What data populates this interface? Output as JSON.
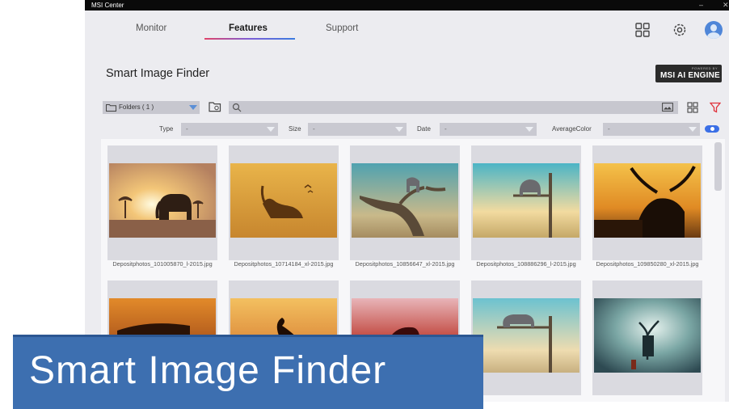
{
  "window": {
    "title": "MSI Center"
  },
  "nav": {
    "tabs": [
      "Monitor",
      "Features",
      "Support"
    ],
    "active_tab": "Features"
  },
  "page": {
    "title": "Smart Image Finder",
    "badge_small": "POWERED BY",
    "badge_main": "MSI AI ENGINE"
  },
  "toolbar": {
    "folder_label": "Folders ( 1 )",
    "search_value": ""
  },
  "filters": {
    "type_label": "Type",
    "type_value": "-",
    "size_label": "Size",
    "size_value": "-",
    "date_label": "Date",
    "date_value": "-",
    "color_label": "AverageColor",
    "color_value": "-"
  },
  "gallery": {
    "files": [
      "Depositphotos_101005870_l-2015.jpg",
      "Depositphotos_10714184_xl-2015.jpg",
      "Depositphotos_10856647_xl-2015.jpg",
      "Depositphotos_108886296_l-2015.jpg",
      "Depositphotos_109850280_xl-2015.jpg"
    ]
  },
  "banner": {
    "text": "Smart Image Finder"
  },
  "colors": {
    "accent": "#3b6fe6",
    "banner": "#3d6fb0",
    "filter": "#e0303a"
  }
}
